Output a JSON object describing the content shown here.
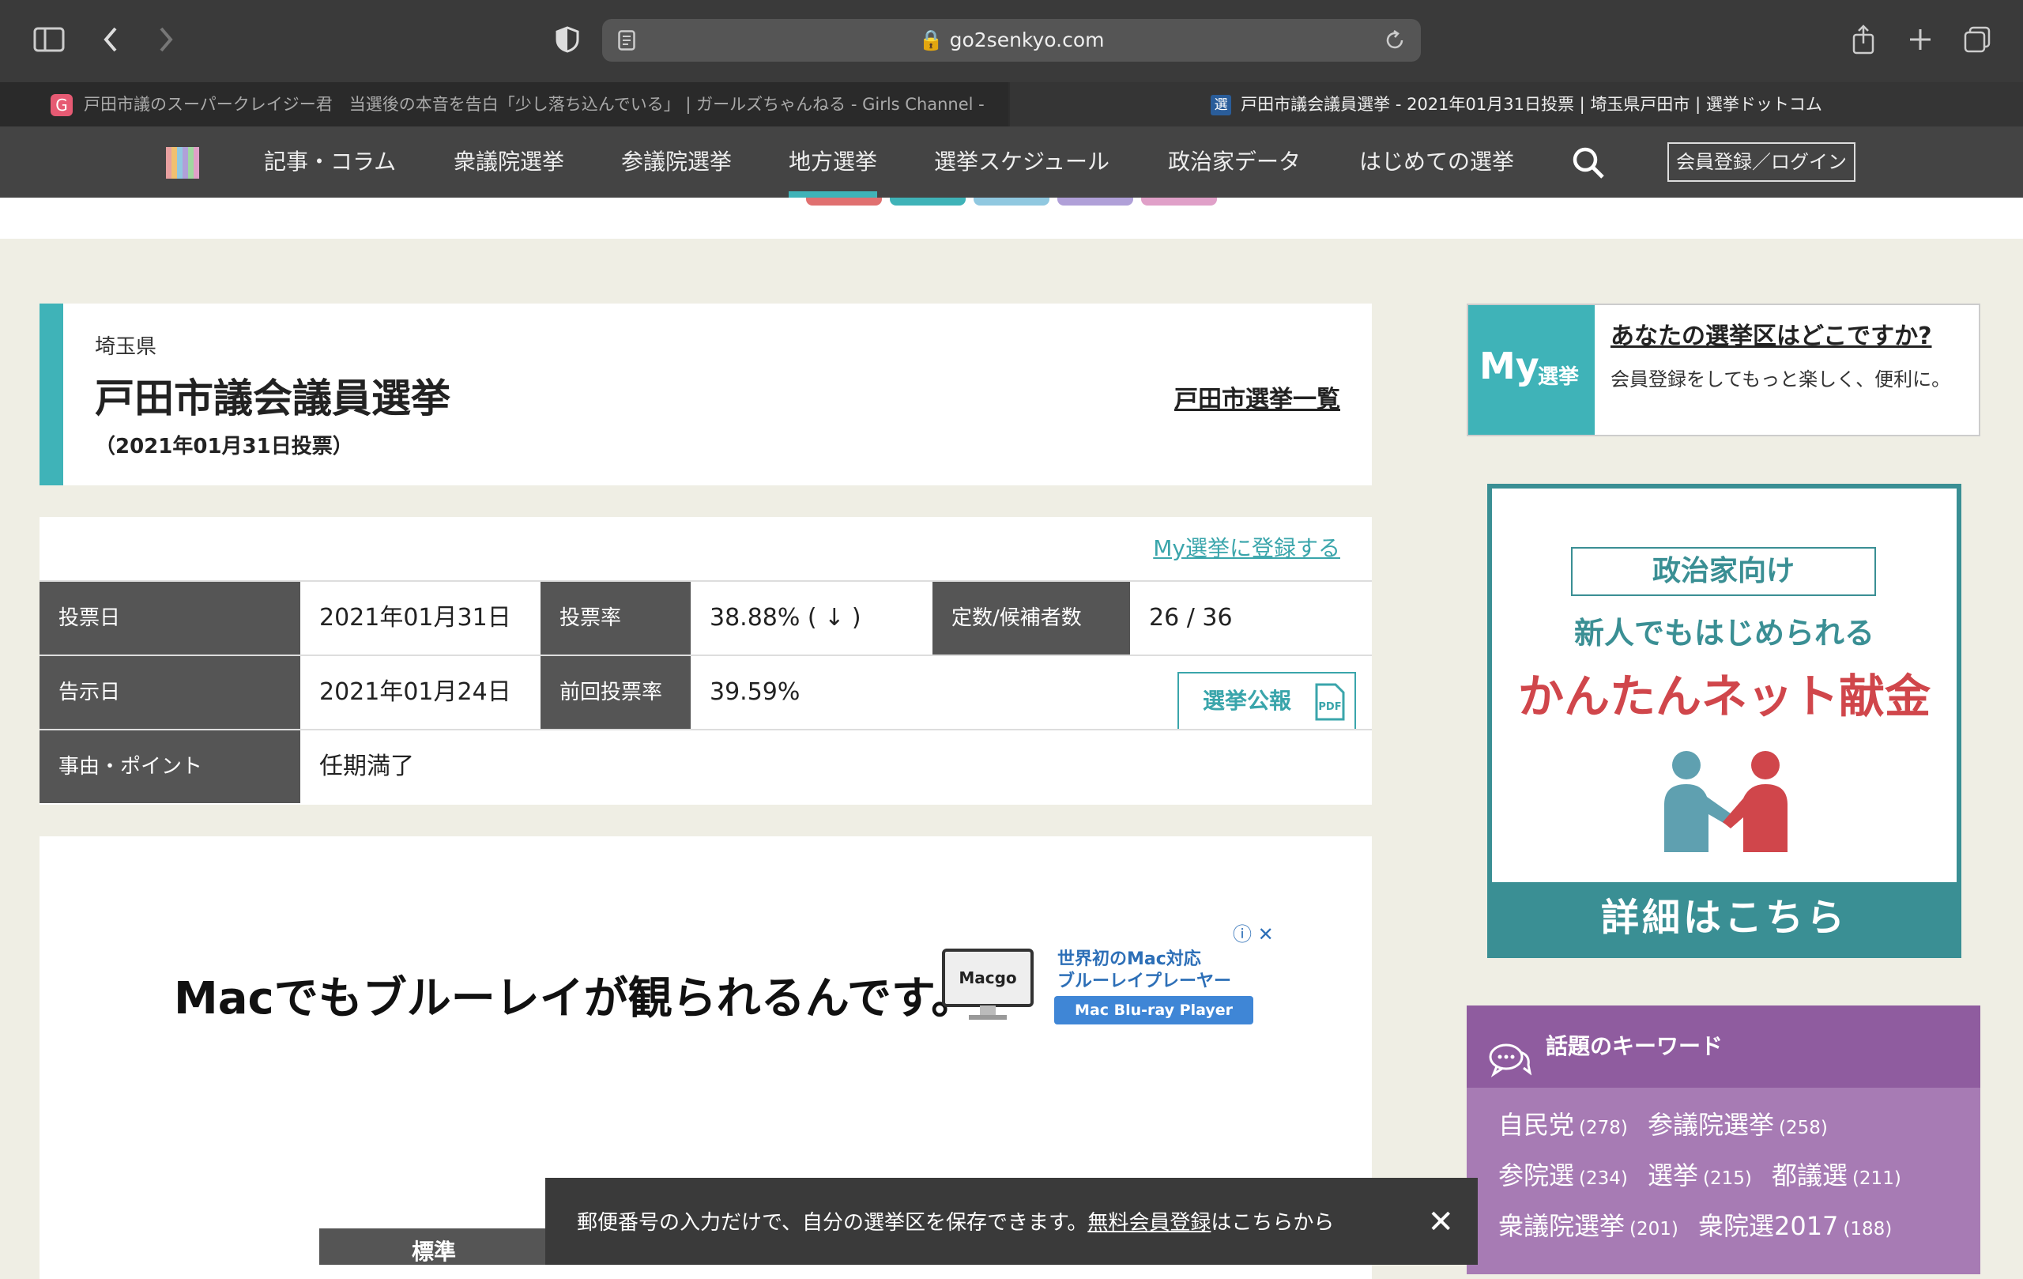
{
  "browser": {
    "url": "go2senkyo.com",
    "tabs": [
      {
        "label": "戸田市議のスーパークレイジー君　当選後の本音を告白「少し落ち込んでいる」 | ガールズちゃんねる - Girls Channel -",
        "favicon": "G"
      },
      {
        "label": "戸田市議会議員選挙 - 2021年01月31日投票 | 埼玉県戸田市 | 選挙ドットコム",
        "favicon": "選"
      }
    ]
  },
  "nav": {
    "items": [
      "記事・コラム",
      "衆議院選挙",
      "参議院選挙",
      "地方選挙",
      "選挙スケジュール",
      "政治家データ",
      "はじめての選挙"
    ],
    "active": "地方選挙",
    "login": "会員登録／ログイン"
  },
  "election": {
    "prefecture": "埼玉県",
    "title": "戸田市議会議員選挙",
    "date": "（2021年01月31日投票）",
    "city_list_link": "戸田市選挙一覧",
    "register_link": "My選挙に登録する"
  },
  "info": {
    "vote_day_label": "投票日",
    "vote_day": "2021年01月31日",
    "turnout_label": "投票率",
    "turnout": "38.88% ( ↓ )",
    "seats_label": "定数/候補者数",
    "seats": "26 / 36",
    "notice_day_label": "告示日",
    "notice_day": "2021年01月24日",
    "prev_turnout_label": "前回投票率",
    "prev_turnout": "39.59%",
    "bulletin_button": "選挙公報",
    "reason_label": "事由・ポイント",
    "reason": "任期満了"
  },
  "ad": {
    "headline": "Macでもブルーレイが観られるんです。",
    "brand": "Macgo",
    "side_line1": "世界初のMac対応",
    "side_line2": "ブルーレイプレーヤー",
    "badge": "Mac Blu-ray Player",
    "controls": "ⓘ ✕"
  },
  "below_tab": "標準",
  "my_election": {
    "badge_big": "My",
    "badge_small": "選挙",
    "question": "あなたの選挙区はどこですか?",
    "desc": "会員登録をしてもっと楽しく、便利に。"
  },
  "donation_banner": {
    "tag": "政治家向け",
    "sub": "新人でもはじめられる",
    "main": "かんたんネット献金",
    "footer": "詳細はこちら"
  },
  "keywords": {
    "title": "話題のキーワード",
    "items": [
      {
        "word": "自民党",
        "count": "(278)"
      },
      {
        "word": "参議院選挙",
        "count": "(258)"
      },
      {
        "word": "参院選",
        "count": "(234)"
      },
      {
        "word": "選挙",
        "count": "(215)"
      },
      {
        "word": "都議選",
        "count": "(211)"
      },
      {
        "word": "衆議院選挙",
        "count": "(201)"
      },
      {
        "word": "衆院選2017",
        "count": "(188)"
      }
    ]
  },
  "notice_bar": {
    "text": "郵便番号の入力だけで、自分の選挙区を保存できます。",
    "link": "無料会員登録",
    "suffix": "はこちらから",
    "close": "✕"
  },
  "colors": {
    "accent": "#3fb3b8",
    "donate_red": "#d0464b",
    "keyword_purple": "#8f5c9f"
  }
}
